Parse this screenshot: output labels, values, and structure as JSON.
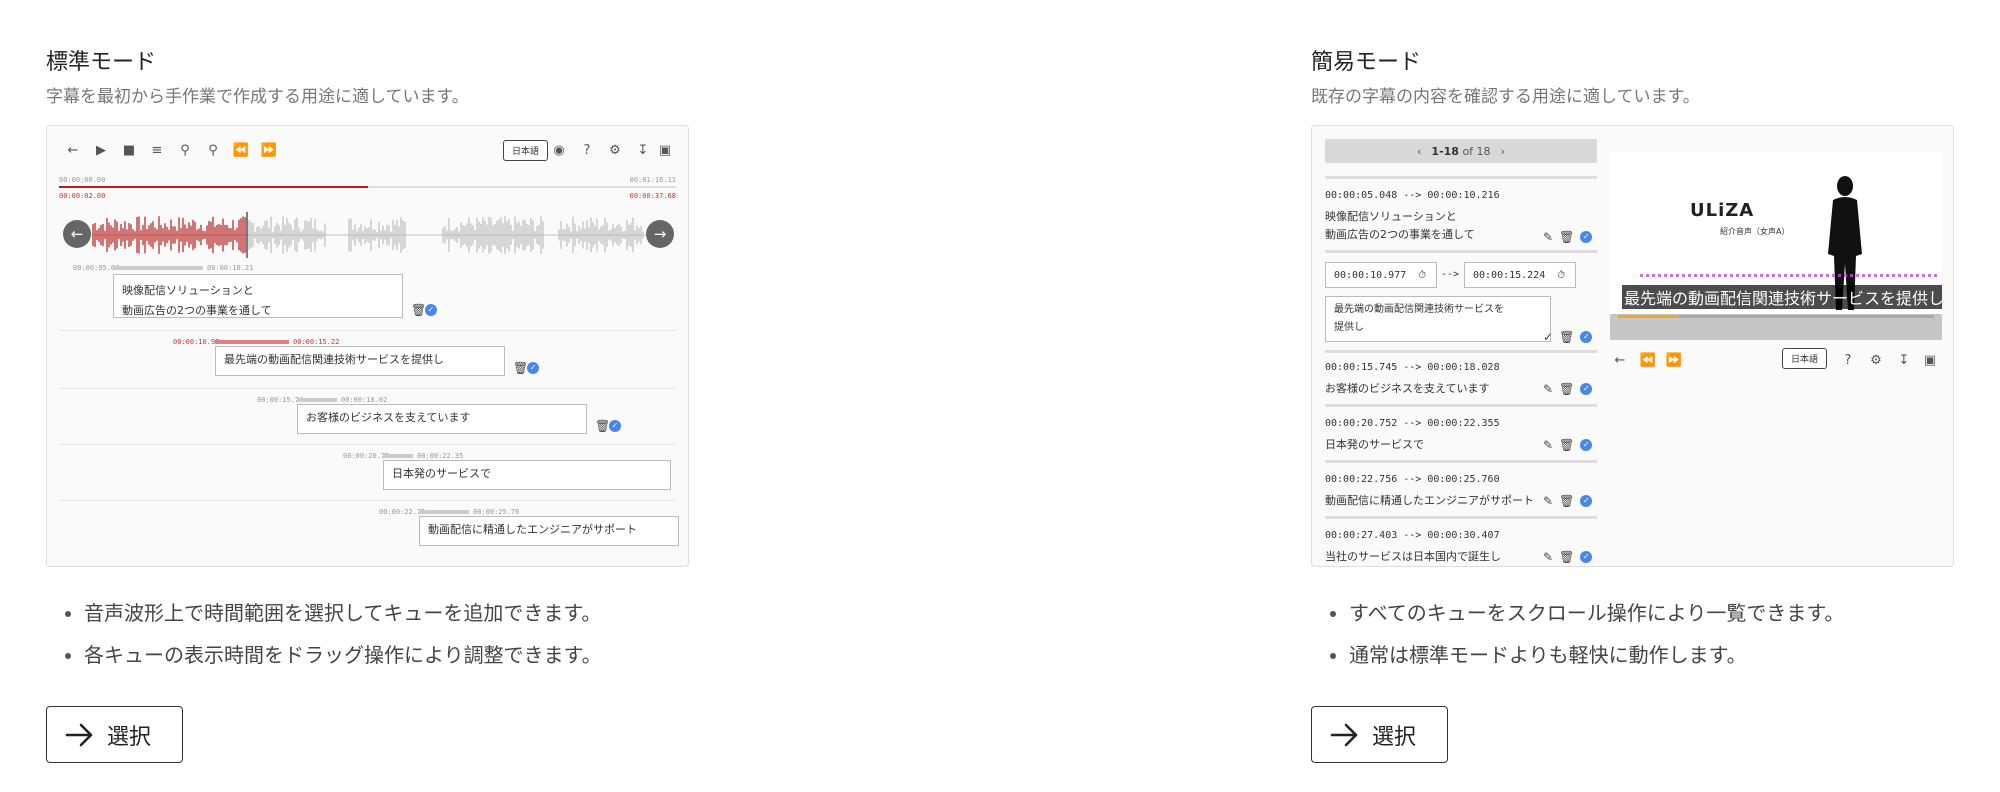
{
  "standard": {
    "title": "標準モード",
    "description": "字幕を最初から手作業で作成する用途に適しています。",
    "bullets": [
      "音声波形上で時間範囲を選択してキューを追加できます。",
      "各キューの表示時間をドラッグ操作により調整できます。"
    ],
    "button_label": "選択",
    "preview": {
      "language": "日本語",
      "time_start": "00:00:00.00",
      "time_end": "00:01:16.11",
      "time_cursor": "00:00:02.00",
      "time_total": "00:00:37.68",
      "playhead_fraction": 0.5,
      "cues": [
        {
          "start": "00:00:05.04",
          "end": "00:00:10.21",
          "lines": [
            "映像配信ソリューションと",
            "動画広告の2つの事業を通して"
          ],
          "active": false
        },
        {
          "start": "00:00:10.97",
          "end": "00:00:15.22",
          "lines": [
            "最先端の動画配信関連技術サービスを提供し"
          ],
          "active": true
        },
        {
          "start": "00:00:15.74",
          "end": "00:00:18.02",
          "lines": [
            "お客様のビジネスを支えています"
          ],
          "active": false
        },
        {
          "start": "00:00:20.75",
          "end": "00:00:22.35",
          "lines": [
            "日本発のサービスで"
          ],
          "active": false
        },
        {
          "start": "00:00:22.75",
          "end": "00:00:25.76",
          "lines": [
            "動画配信に精通したエンジニアがサポート"
          ],
          "active": false
        }
      ]
    }
  },
  "simple": {
    "title": "簡易モード",
    "description": "既存の字幕の内容を確認する用途に適しています。",
    "bullets": [
      "すべてのキューをスクロール操作により一覧できます。",
      "通常は標準モードよりも軽快に動作します。"
    ],
    "button_label": "選択",
    "preview": {
      "pager_range": "1-18",
      "pager_of": "of 18",
      "cue1_time": "00:00:05.048 --> 00:00:10.216",
      "cue1_lines": [
        "映像配信ソリューションと",
        "動画広告の2つの事業を通して"
      ],
      "edit_start": "00:00:10.977",
      "edit_arrow": "-->",
      "edit_end": "00:00:15.224",
      "edit_lines": [
        "最先端の動画配信関連技術サービスを",
        "提供し"
      ],
      "cues": [
        {
          "time": "00:00:15.745 --> 00:00:18.028",
          "text": "お客様のビジネスを支えています"
        },
        {
          "time": "00:00:20.752 --> 00:00:22.355",
          "text": "日本発のサービスで"
        },
        {
          "time": "00:00:22.756 --> 00:00:25.760",
          "text": "動画配信に精通したエンジニアがサポート"
        },
        {
          "time": "00:00:27.403 --> 00:00:30.407",
          "text": "当社のサービスは日本国内で誕生し"
        }
      ],
      "video_logo": "ULiZA",
      "video_logo_sub": "紹介音声（女声A）",
      "video_caption": "最先端の動画配信関連技術サービスを提供し",
      "language": "日本語"
    }
  },
  "colors": {
    "waveform_active": "#b71c1c",
    "waveform_idle": "#bdbdbd",
    "check_blue": "#4a86e8",
    "progress_orange": "#f5a623"
  },
  "icons": [
    "back-icon",
    "play-icon",
    "stop-icon",
    "add-queue-icon",
    "zoom-in-icon",
    "zoom-out-icon",
    "rewind-icon",
    "fast-forward-icon",
    "eye-icon",
    "help-icon",
    "gear-icon",
    "download-icon",
    "save-icon",
    "trash-icon",
    "check-icon",
    "pencil-icon",
    "timer-icon",
    "arrow-right-icon"
  ]
}
